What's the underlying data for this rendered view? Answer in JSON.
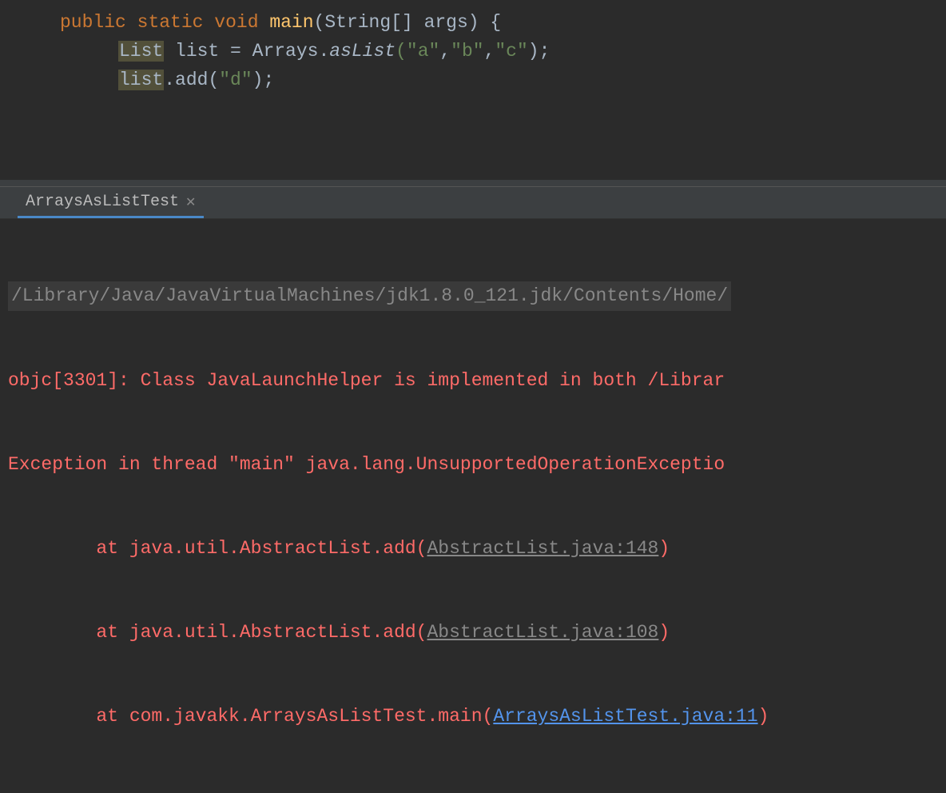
{
  "editor": {
    "line1": {
      "kw_public": "public",
      "kw_static": "static",
      "kw_void": "void",
      "method": "main",
      "params_open": "(",
      "param_type": "String[] args",
      "params_close": ") {"
    },
    "line2": {
      "type": "List",
      "var": " list = Arrays.",
      "static_method": "asList",
      "args": "(\"a\",\"b\",\"c\");"
    },
    "line3": {
      "var": "list",
      "call": ".add",
      "args": "(\"d\");"
    }
  },
  "tab": {
    "label": "ArraysAsListTest"
  },
  "console": {
    "cmd": "/Library/Java/JavaVirtualMachines/jdk1.8.0_121.jdk/Contents/Home/",
    "line1": "objc[3301]: Class JavaLaunchHelper is implemented in both /Librar",
    "line2": "Exception in thread \"main\" java.lang.UnsupportedOperationExceptio",
    "trace1_pre": "\tat java.util.AbstractList.add(",
    "trace1_link": "AbstractList.java:148",
    "trace1_post": ")",
    "trace2_pre": "\tat java.util.AbstractList.add(",
    "trace2_link": "AbstractList.java:108",
    "trace2_post": ")",
    "trace3_pre": "\tat com.javakk.ArraysAsListTest.main(",
    "trace3_link": "ArraysAsListTest.java:11",
    "trace3_post": ")"
  }
}
